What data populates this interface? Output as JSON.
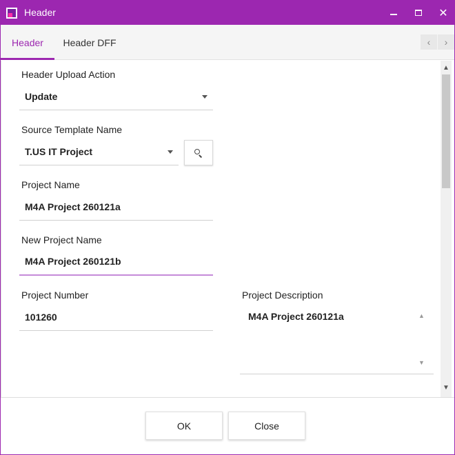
{
  "window": {
    "title": "Header",
    "minimize_icon": "minimize-icon",
    "maximize_icon": "maximize-icon",
    "close_glyph": "✕"
  },
  "tabs": [
    {
      "label": "Header",
      "active": true
    },
    {
      "label": "Header DFF",
      "active": false
    }
  ],
  "tab_nav": {
    "prev": "‹",
    "next": "›"
  },
  "form": {
    "upload_action": {
      "label": "Header Upload Action",
      "value": "Update"
    },
    "source_template": {
      "label": "Source Template Name",
      "value": "T.US IT Project"
    },
    "project_name": {
      "label": "Project Name",
      "value": "M4A Project 260121a"
    },
    "new_project_name": {
      "label": "New Project Name",
      "value": "M4A Project 260121b"
    },
    "project_number": {
      "label": "Project Number",
      "value": "101260"
    },
    "project_description": {
      "label": "Project Description",
      "value": "M4A Project 260121a"
    }
  },
  "footer": {
    "ok_label": "OK",
    "close_label": "Close"
  },
  "colors": {
    "accent": "#9c27b0",
    "focus_underline": "#c58ad9"
  }
}
